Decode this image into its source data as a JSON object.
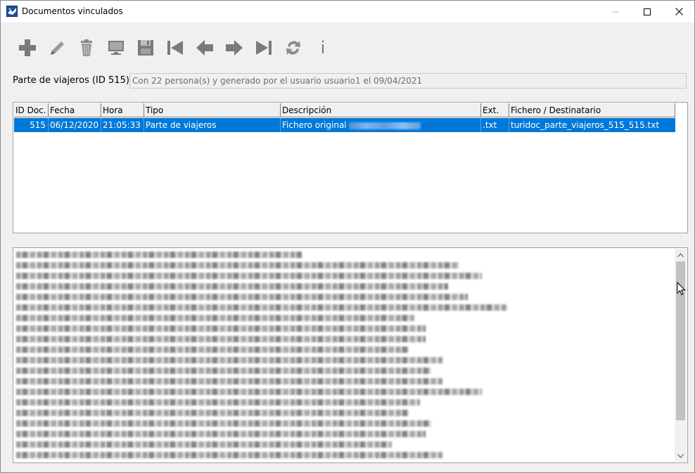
{
  "window": {
    "title": "Documentos vinculados"
  },
  "toolbar": {
    "buttons": [
      {
        "name": "add-icon"
      },
      {
        "name": "edit-icon"
      },
      {
        "name": "delete-icon"
      },
      {
        "name": "monitor-icon"
      },
      {
        "name": "save-icon"
      },
      {
        "name": "first-record-icon"
      },
      {
        "name": "previous-record-icon"
      },
      {
        "name": "next-record-icon"
      },
      {
        "name": "last-record-icon"
      },
      {
        "name": "refresh-icon"
      },
      {
        "name": "info-icon",
        "glyph": "i"
      }
    ]
  },
  "record": {
    "label": "Parte de viajeros (ID 515)",
    "info": "Con 22 persona(s) y generado por el usuario usuario1 el 09/04/2021"
  },
  "table": {
    "columns": [
      "ID Doc.",
      "Fecha",
      "Hora",
      "Tipo",
      "Descripción",
      "Ext.",
      "Fichero / Destinatario"
    ],
    "rows": [
      {
        "id": "515",
        "fecha": "06/12/2020",
        "hora": "21:05:33",
        "tipo": "Parte de viajeros",
        "descripcion": "Fichero original",
        "ext": ".txt",
        "fichero": "turidoc_parte_viajeros_515_515.txt"
      }
    ]
  },
  "colors": {
    "selection": "#0078d7",
    "icon_gray": "#7a7a7a"
  }
}
